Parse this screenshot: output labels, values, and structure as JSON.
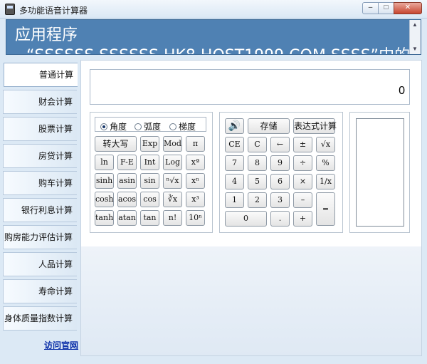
{
  "window": {
    "title": "多功能语音计算器",
    "min": "–",
    "max": "□",
    "close": "✕"
  },
  "banner": {
    "line1": "应用程序",
    "line2": "“SSSSSS SSSSSS HK8 HOST1999 COM SSSS”中的",
    "scroll_up": "▲",
    "scroll_down": "▼"
  },
  "sidebar": {
    "items": [
      {
        "label": "普通计算"
      },
      {
        "label": "财会计算"
      },
      {
        "label": "股票计算"
      },
      {
        "label": "房贷计算"
      },
      {
        "label": "购车计算"
      },
      {
        "label": "银行利息计算"
      },
      {
        "label": "购房能力评估计算"
      },
      {
        "label": "人品计算"
      },
      {
        "label": "寿命计算"
      },
      {
        "label": "身体质量指数计算"
      }
    ],
    "visit_link": "访问官网"
  },
  "display": {
    "value": "0"
  },
  "modes": {
    "options": [
      "角度",
      "弧度",
      "梯度"
    ],
    "selected": "角度"
  },
  "sci": {
    "row1": [
      "转大写",
      "Exp",
      "Mod",
      "π"
    ],
    "row2": [
      "ln",
      "F-E",
      "Int",
      "Log",
      "xª"
    ],
    "row3": [
      "sinh",
      "asin",
      "sin",
      "ⁿ√x",
      "xⁿ"
    ],
    "row4": [
      "cosh",
      "acos",
      "cos",
      "∛x",
      "x³"
    ],
    "row5": [
      "tanh",
      "atan",
      "tan",
      "n!",
      "10ⁿ"
    ]
  },
  "basic": {
    "speaker": "🔊",
    "store": "存储",
    "expr": "表达式计算",
    "row2": [
      "CE",
      "C",
      "←",
      "±",
      "√x"
    ],
    "row3": [
      "7",
      "8",
      "9",
      "÷",
      "%"
    ],
    "row4": [
      "4",
      "5",
      "6",
      "×",
      "1/x"
    ],
    "row5": [
      "1",
      "2",
      "3",
      "–"
    ],
    "zero": "0",
    "dot": ".",
    "plus": "+",
    "equals": "="
  }
}
